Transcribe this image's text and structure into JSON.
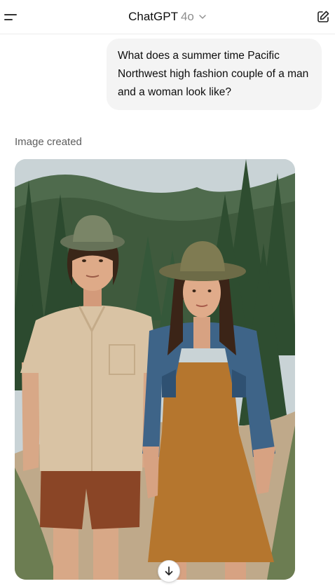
{
  "header": {
    "title": "ChatGPT",
    "model": "4o",
    "menu_icon": "menu-icon",
    "model_chevron_icon": "chevron-down-icon",
    "new_chat_icon": "new-chat-edit-icon"
  },
  "conversation": {
    "user_message": "What does a summer time Pacific Northwest high fashion couple of a man and a woman look like?",
    "assistant_status": "Image created",
    "generated_image_icon": "generated-image",
    "scroll_down_icon": "arrow-down-icon"
  },
  "colors": {
    "bubble_bg": "#f4f4f4",
    "status_text": "#5d5d5d",
    "model_text": "#8e8e8e"
  }
}
